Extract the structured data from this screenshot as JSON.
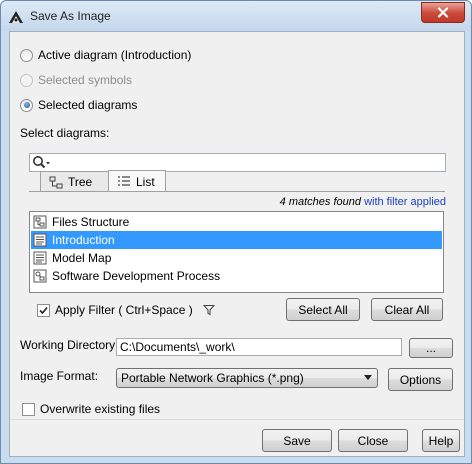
{
  "window": {
    "title": "Save As Image"
  },
  "options": {
    "active_diagram": "Active diagram (Introduction)",
    "selected_symbols": "Selected symbols",
    "selected_diagrams": "Selected diagrams",
    "selected_choice": "selected_diagrams"
  },
  "select_label": "Select diagrams:",
  "search": {
    "value": ""
  },
  "tabs": [
    {
      "label": "Tree",
      "active": false
    },
    {
      "label": "List",
      "active": true
    }
  ],
  "filter_status": {
    "count_text": "4 matches found",
    "applied_text": "with filter applied"
  },
  "diagrams": [
    {
      "label": "Files Structure",
      "selected": false
    },
    {
      "label": "Introduction",
      "selected": true
    },
    {
      "label": "Model Map",
      "selected": false
    },
    {
      "label": "Software Development Process",
      "selected": false
    }
  ],
  "apply_filter": {
    "label": "Apply Filter ( Ctrl+Space )",
    "checked": true
  },
  "buttons": {
    "select_all": "Select All",
    "clear_all": "Clear All",
    "browse": "...",
    "options": "Options",
    "save": "Save",
    "close": "Close",
    "help": "Help"
  },
  "working_directory": {
    "label": "Working Directory:",
    "value": "C:\\Documents\\_work\\"
  },
  "image_format": {
    "label": "Image Format:",
    "value": "Portable Network Graphics (*.png)"
  },
  "overwrite": {
    "label": "Overwrite existing files",
    "checked": false
  },
  "colors": {
    "selection": "#3399ff",
    "filter_link": "#1d3fbf",
    "close_button": "#c8493a"
  }
}
